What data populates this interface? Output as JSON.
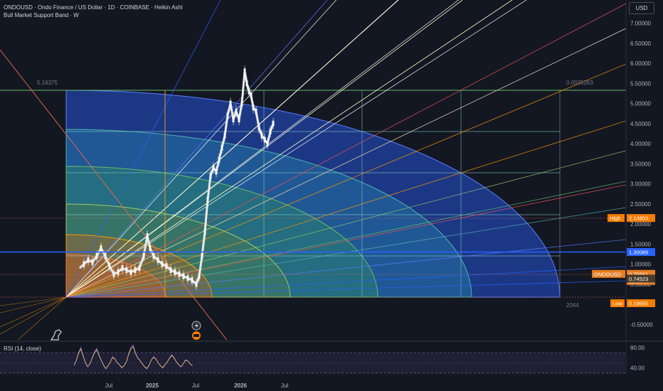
{
  "header": {
    "title": "ONDOUSD · Ondo Finance / US Dollar · 1D · COINBASE · Heikin Ashi",
    "indicator": "Bull Market Support Band · W",
    "currency_button": "USD"
  },
  "price_axis": {
    "ticks": [
      "7.00000",
      "6.50000",
      "6.00000",
      "5.50000",
      "5.00000",
      "4.50000",
      "4.00000",
      "3.50000",
      "3.00000",
      "2.50000",
      "2.00000",
      "1.50000",
      "1.00000",
      "0.50000",
      "0.00000",
      "-0.50000"
    ],
    "tick_values": [
      7.0,
      6.5,
      6.0,
      5.5,
      5.0,
      4.5,
      4.0,
      3.5,
      3.0,
      2.5,
      2.0,
      1.5,
      1.0,
      0.5,
      0.0,
      -0.5
    ]
  },
  "price_labels": {
    "high_label": "High",
    "high_value": "2.14803",
    "high_price": 2.14803,
    "hline_value": "1.30089",
    "hline_price": 1.30089,
    "symbol": "ONDOUSD",
    "last_value": "0.75661",
    "countdown": "05:36:47",
    "last_price": 0.75661,
    "prev_value": "0.74523",
    "prev_price": 0.74523,
    "low_label": "Low",
    "low_value": "0.19655",
    "low_price": 0.19655
  },
  "annotations": {
    "top_left": "5.16375",
    "top_right": "0.0025263",
    "bottom_right": "2044"
  },
  "time_axis": {
    "labels": [
      "Jul",
      "2025",
      "Jul",
      "2026",
      "Jul"
    ],
    "bold": [
      false,
      true,
      false,
      true,
      false
    ]
  },
  "rsi": {
    "label": "RSI (14, close)",
    "ticks": [
      "80.00",
      "40.00"
    ],
    "tick_values": [
      80,
      40
    ]
  },
  "colors": {
    "background": "#131722",
    "candles": "#e8e8e8",
    "blue_line": "#2962ff",
    "high_badge": "#f57c00",
    "low_badge": "#f57c00",
    "hline_badge": "#2962ff",
    "last_badge": "#e67e22",
    "rsi_line": "#7e57c2"
  }
}
